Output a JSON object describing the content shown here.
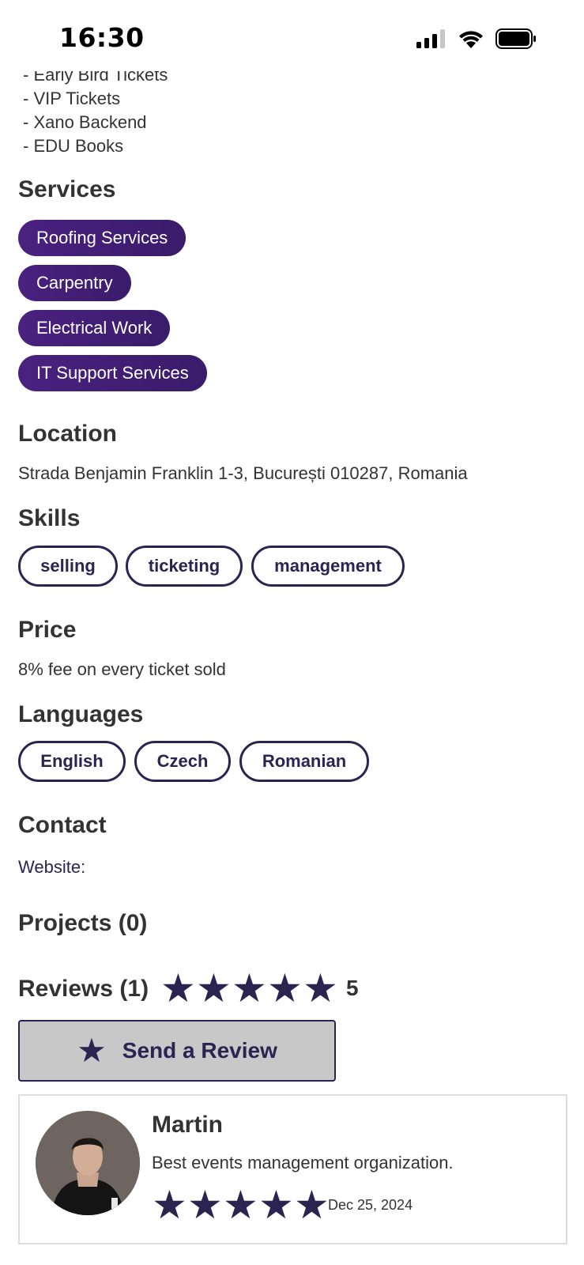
{
  "status_bar": {
    "time": "16:30"
  },
  "top_list": [
    "- Early Bird Tickets",
    "- VIP Tickets",
    "- Xano Backend",
    "- EDU Books"
  ],
  "services": {
    "title": "Services",
    "items": [
      "Roofing Services",
      "Carpentry",
      "Electrical Work",
      "IT Support Services"
    ]
  },
  "location": {
    "title": "Location",
    "address": "Strada Benjamin Franklin 1-3, București 010287, Romania"
  },
  "skills": {
    "title": "Skills",
    "items": [
      "selling",
      "ticketing",
      "management"
    ]
  },
  "price": {
    "title": "Price",
    "text": "8% fee on every ticket sold"
  },
  "languages": {
    "title": "Languages",
    "items": [
      "English",
      "Czech",
      "Romanian"
    ]
  },
  "contact": {
    "title": "Contact",
    "website_label": "Website:"
  },
  "projects": {
    "title": "Projects (0)"
  },
  "reviews": {
    "title": "Reviews (1)",
    "rating": 5,
    "rating_text": "5",
    "send_button_label": "Send a Review",
    "items": [
      {
        "name": "Martin",
        "text": "Best events management organization.",
        "rating": 5,
        "date": "Dec 25, 2024"
      }
    ]
  },
  "colors": {
    "accent": "#2b2350",
    "chip_purple": "#4a2180",
    "button_gray": "#c8c8c8"
  }
}
